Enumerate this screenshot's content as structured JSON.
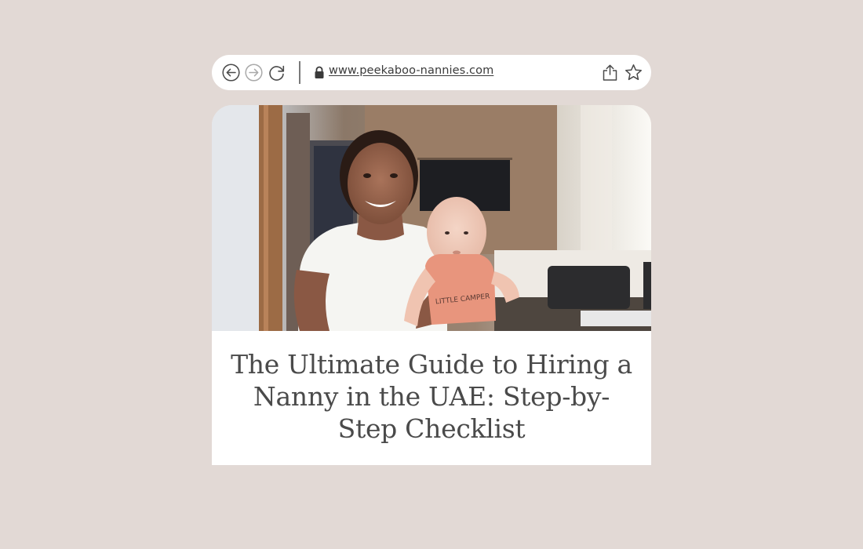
{
  "browser": {
    "url": "www.peekaboo-nannies.com",
    "icons": {
      "back": "back-arrow-icon",
      "forward": "forward-arrow-icon",
      "reload": "reload-icon",
      "lock": "lock-icon",
      "share": "share-icon",
      "bookmark": "star-icon"
    }
  },
  "article": {
    "image_subject": "woman-holding-baby-photo",
    "baby_shirt_text": "LITTLE CAMPER",
    "title": "The Ultimate Guide to Hiring a Nanny in the UAE: Step-by-Step Checklist"
  },
  "colors": {
    "background": "#e2d9d5",
    "card": "#ffffff",
    "text": "#4a4a4a"
  }
}
